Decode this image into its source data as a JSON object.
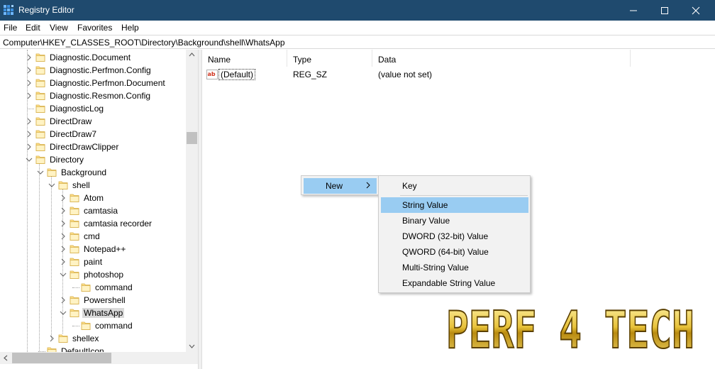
{
  "window": {
    "title": "Registry Editor",
    "colors": {
      "titlebar": "#1f4a6e",
      "highlight": "#99ccf2",
      "selected": "#d9d9d9"
    }
  },
  "menubar": {
    "items": [
      "File",
      "Edit",
      "View",
      "Favorites",
      "Help"
    ]
  },
  "address": "Computer\\HKEY_CLASSES_ROOT\\Directory\\Background\\shell\\WhatsApp",
  "tree": {
    "items": [
      {
        "label": "Diagnostic.Document",
        "expander": "collapsed"
      },
      {
        "label": "Diagnostic.Perfmon.Config",
        "expander": "collapsed"
      },
      {
        "label": "Diagnostic.Perfmon.Document",
        "expander": "collapsed"
      },
      {
        "label": "Diagnostic.Resmon.Config",
        "expander": "collapsed"
      },
      {
        "label": "DiagnosticLog",
        "expander": "none"
      },
      {
        "label": "DirectDraw",
        "expander": "collapsed"
      },
      {
        "label": "DirectDraw7",
        "expander": "collapsed"
      },
      {
        "label": "DirectDrawClipper",
        "expander": "collapsed"
      },
      {
        "label": "Directory",
        "expander": "expanded"
      },
      {
        "label": "Background",
        "expander": "expanded"
      },
      {
        "label": "shell",
        "expander": "expanded"
      },
      {
        "label": "Atom",
        "expander": "collapsed"
      },
      {
        "label": "camtasia",
        "expander": "collapsed"
      },
      {
        "label": "camtasia recorder",
        "expander": "collapsed"
      },
      {
        "label": "cmd",
        "expander": "collapsed"
      },
      {
        "label": "Notepad++",
        "expander": "collapsed"
      },
      {
        "label": "paint",
        "expander": "collapsed"
      },
      {
        "label": "photoshop",
        "expander": "expanded"
      },
      {
        "label": "command",
        "expander": "none"
      },
      {
        "label": "Powershell",
        "expander": "collapsed"
      },
      {
        "label": "WhatsApp",
        "expander": "expanded",
        "selected": true
      },
      {
        "label": "command",
        "expander": "none"
      },
      {
        "label": "shellex",
        "expander": "collapsed"
      },
      {
        "label": "DefaultIcon",
        "expander": "none"
      }
    ]
  },
  "list": {
    "columns": [
      "Name",
      "Type",
      "Data"
    ],
    "rows": [
      {
        "name": "(Default)",
        "type": "REG_SZ",
        "data": "(value not set)",
        "icon": "string-value-icon"
      }
    ]
  },
  "context_menu": {
    "new_label": "New",
    "arrow": "›"
  },
  "submenu": {
    "items": [
      {
        "label": "Key",
        "highlighted": false
      },
      {
        "label": "String Value",
        "highlighted": true
      },
      {
        "label": "Binary Value",
        "highlighted": false
      },
      {
        "label": "DWORD (32-bit) Value",
        "highlighted": false
      },
      {
        "label": "QWORD (64-bit) Value",
        "highlighted": false
      },
      {
        "label": "Multi-String Value",
        "highlighted": false
      },
      {
        "label": "Expandable String Value",
        "highlighted": false
      }
    ]
  },
  "watermark": {
    "text": "PERF 4 TECH"
  }
}
